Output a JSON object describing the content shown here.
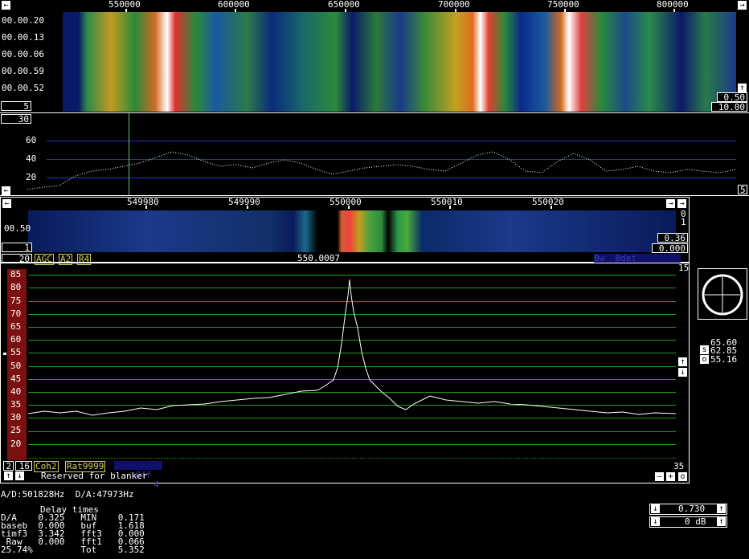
{
  "wide_waterfall": {
    "freq_labels": [
      "550000",
      "600000",
      "650000",
      "700000",
      "750000",
      "800000"
    ],
    "time_labels": [
      "00.00.20",
      "00.00.13",
      "00.00.06",
      "00.00.59",
      "00.00.52"
    ],
    "avg_value": "5",
    "gain_value": "0.50",
    "zero_value": "10.00"
  },
  "wide_spectrum": {
    "avg_value": "30",
    "y_labels": [
      "60",
      "40",
      "20"
    ],
    "right_value": "5"
  },
  "hires_waterfall": {
    "freq_labels": [
      "549980",
      "549990",
      "550000",
      "550010",
      "550020"
    ],
    "time_label": "00.50",
    "avg_value": "1",
    "right_top": "0",
    "right_second": "1",
    "gain_value": "0.36",
    "zero_value": "0.000"
  },
  "baseband_toolbar": {
    "bw_value": "20",
    "agc_label": "AGC",
    "a_label": "A2",
    "r_label": "R4",
    "freq_readout": "550.0007",
    "blue_text": "Bw  Bdet"
  },
  "baseband": {
    "y_labels": [
      "85",
      "80",
      "75",
      "70",
      "65",
      "60",
      "55",
      "50",
      "45",
      "40",
      "35",
      "30",
      "25",
      "20"
    ],
    "top_right": "15",
    "bottom_right": "35",
    "tb_val1": "2",
    "tb_val2": "16",
    "coh_label": "Coh2",
    "rat_label": "Rat9999",
    "off_label": "Off",
    "off_val": "4",
    "blanker_text": "Reserved for blanker"
  },
  "smeter": {
    "val1": "65.60",
    "s_label": "s",
    "val2": "62.85",
    "o_label": "o",
    "val3": "55.16"
  },
  "status": {
    "rates": "A/D:501828Hz  D/A:47973Hz",
    "delay_title": "Delay times",
    "lines": [
      "D/A    0.325   MIN    0.171",
      "baseb  0.000   buf    1.618",
      "timf3  3.342   fft3   0.000",
      " Raw   0.000   fft1   0.066",
      "25.74%         Tot    5.352"
    ]
  },
  "volume": {
    "value": "0.730",
    "db_value": "0 dB"
  },
  "colors": {
    "spectrum_blue": "#2233cc",
    "baseband_green": "#1f9a1f",
    "meter_red": "#7a1010"
  }
}
